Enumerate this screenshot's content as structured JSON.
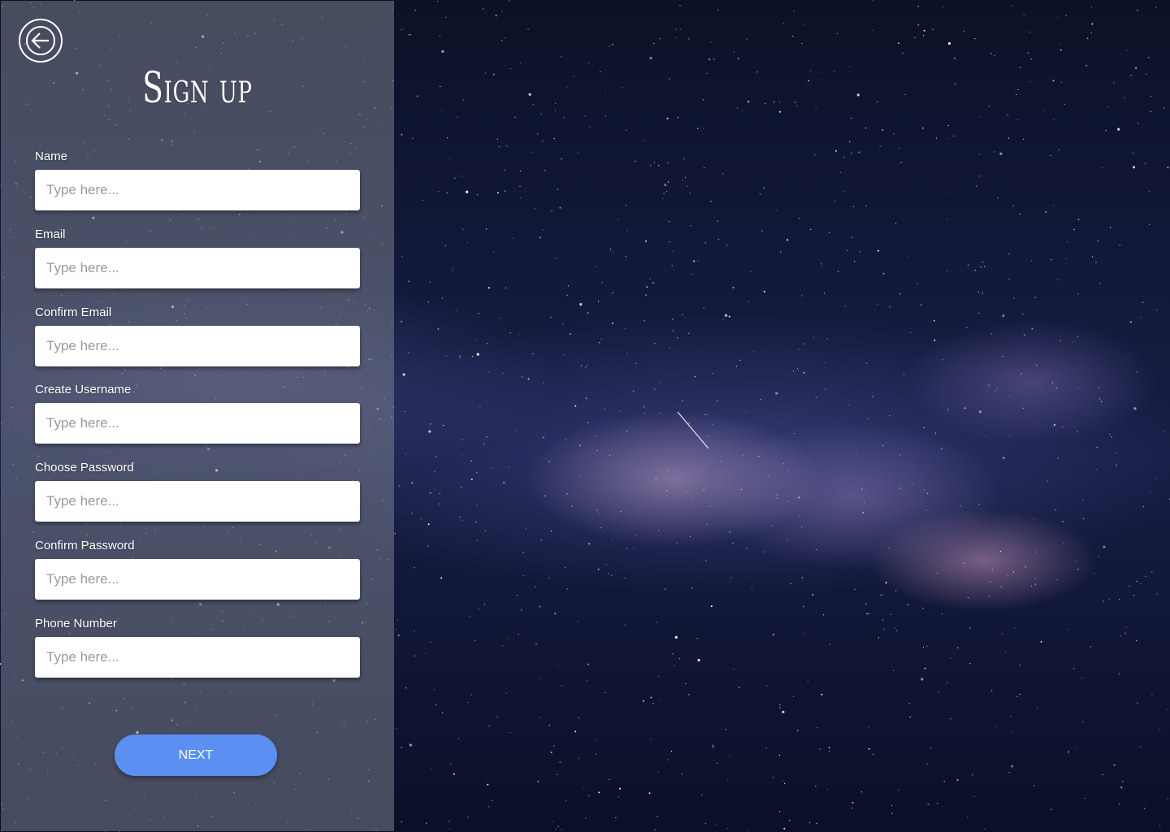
{
  "header": {
    "title": "Sign up",
    "back_icon": "back-arrow-icon"
  },
  "form": {
    "fields": [
      {
        "label": "Name",
        "placeholder": "Type here..."
      },
      {
        "label": "Email",
        "placeholder": "Type here..."
      },
      {
        "label": "Confirm Email",
        "placeholder": "Type here..."
      },
      {
        "label": "Create Username",
        "placeholder": "Type here..."
      },
      {
        "label": "Choose Password",
        "placeholder": "Type here..."
      },
      {
        "label": "Confirm Password",
        "placeholder": "Type here..."
      },
      {
        "label": "Phone Number",
        "placeholder": "Type here..."
      }
    ],
    "next_label": "NEXT"
  },
  "colors": {
    "accent": "#5b8ff2",
    "background": "#121a3c"
  }
}
